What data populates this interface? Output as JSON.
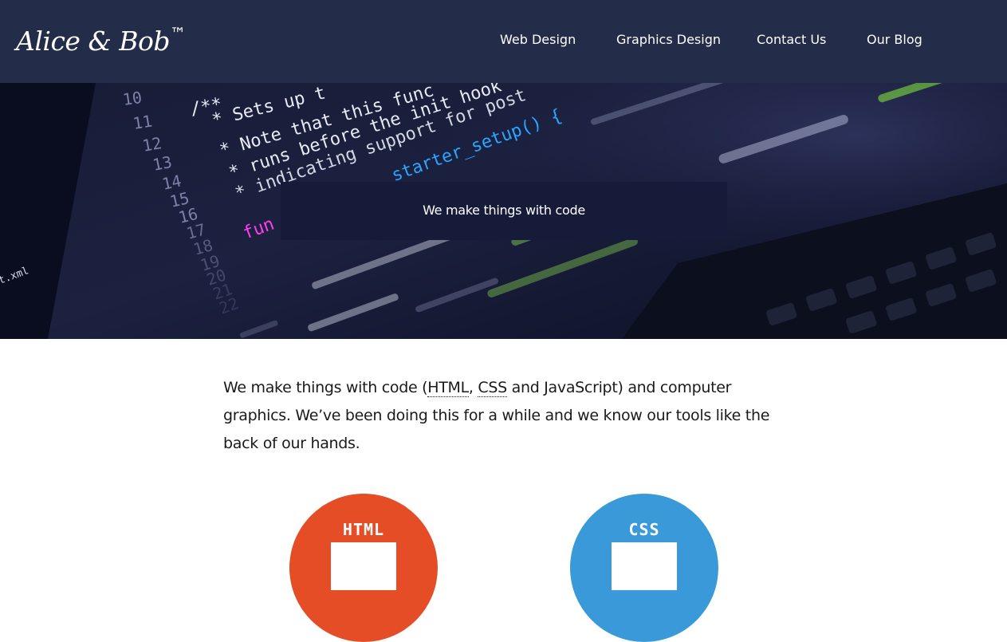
{
  "brand": {
    "name": "Alice & Bob",
    "trademark": "™"
  },
  "nav": {
    "items": [
      {
        "label": "Web Design"
      },
      {
        "label": "Graphics Design"
      },
      {
        "label": "Contact Us"
      },
      {
        "label": "Our Blog"
      }
    ]
  },
  "hero": {
    "tagline": "We make things with code",
    "code_lines": {
      "numbers": [
        "10",
        "11",
        "12",
        "13",
        "14",
        "15",
        "16",
        "17",
        "18",
        "19",
        "20",
        "21",
        "22"
      ],
      "text": [
        "/**",
        "* Sets up t",
        "* Note that this func",
        "* runs before the init hook",
        "* indicating support for post",
        "_starter_setup() {",
        "fun"
      ],
      "file": "t.xml"
    }
  },
  "intro": {
    "part1": "We make things with code (",
    "abbr_html": "HTML",
    "sep": ", ",
    "abbr_css": "CSS",
    "part2": " and JavaScript) and computer graphics. We’ve been doing this for a while and we know our tools like the back of our hands."
  },
  "icons": {
    "html": {
      "label": "HTML",
      "color": "#e44d26"
    },
    "css": {
      "label": "CSS",
      "color": "#3a9ad9"
    }
  },
  "colors": {
    "navbar": "#232c48",
    "hero_overlay": "#151b38"
  }
}
